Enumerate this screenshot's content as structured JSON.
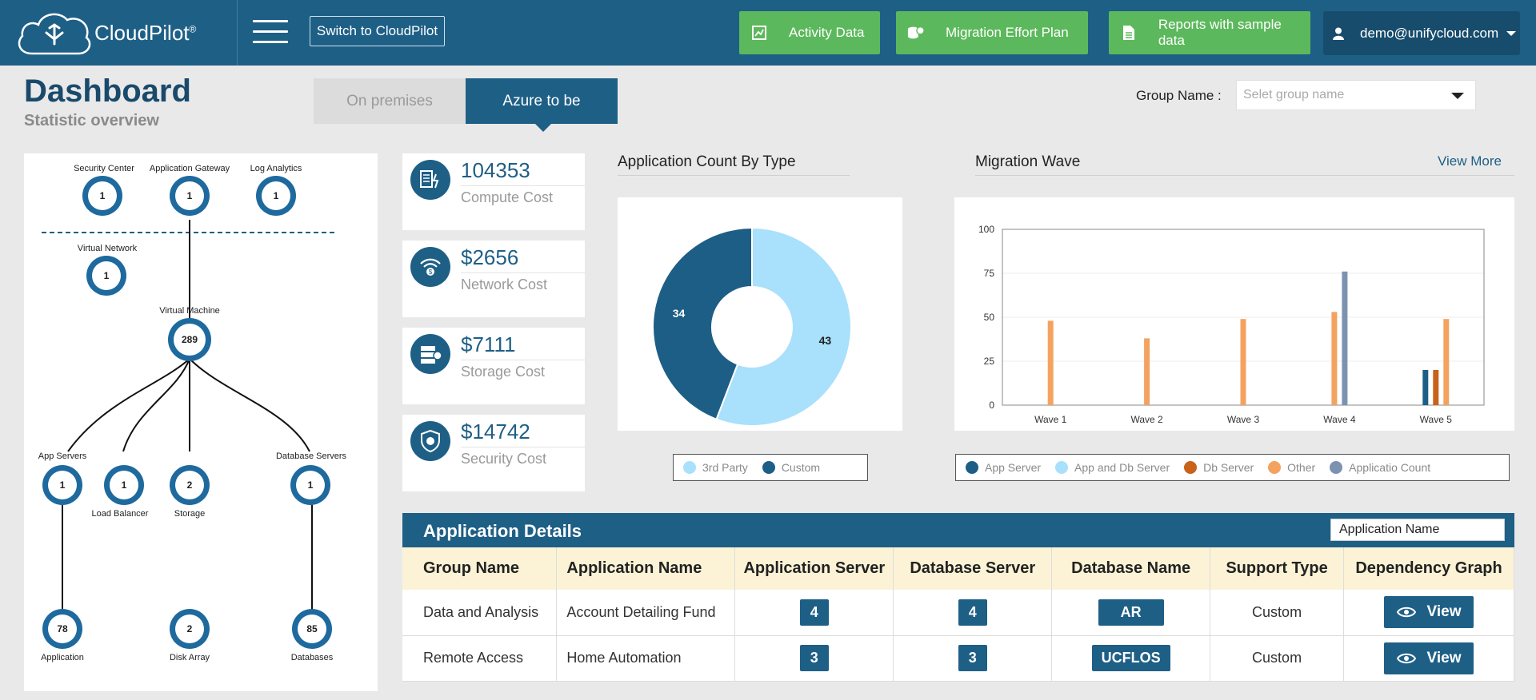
{
  "brand": {
    "name": "CloudPilot",
    "reg": "®"
  },
  "topbar": {
    "switch_label": "Switch to CloudPilot",
    "activity_label": "Activity Data",
    "migration_plan_label": "Migration Effort Plan",
    "reports_label": "Reports with sample data",
    "user_email": "demo@unifycloud.com"
  },
  "header": {
    "title": "Dashboard",
    "subtitle": "Statistic overview"
  },
  "tabs": {
    "onprem": "On premises",
    "azure": "Azure to be"
  },
  "group": {
    "label": "Group Name :",
    "placeholder": "Selet group name"
  },
  "topology": {
    "security_center": {
      "label": "Security Center",
      "count": "1"
    },
    "app_gateway": {
      "label": "Application Gateway",
      "count": "1"
    },
    "log_analytics": {
      "label": "Log Analytics",
      "count": "1"
    },
    "virtual_network": {
      "label": "Virtual Network",
      "count": "1"
    },
    "virtual_machine": {
      "label": "Virtual Machine",
      "count": "289"
    },
    "app_servers": {
      "label": "App Servers",
      "count": "1"
    },
    "load_balancer": {
      "label": "Load Balancer",
      "count": "1"
    },
    "storage": {
      "label": "Storage",
      "count": "2"
    },
    "database_servers": {
      "label": "Database Servers",
      "count": "1"
    },
    "application": {
      "label": "Application",
      "count": "78"
    },
    "disk_array": {
      "label": "Disk Array",
      "count": "2"
    },
    "databases": {
      "label": "Databases",
      "count": "85"
    }
  },
  "stats": {
    "compute": {
      "value": "104353",
      "label": "Compute Cost"
    },
    "network": {
      "value": "$2656",
      "label": "Network Cost"
    },
    "storage": {
      "value": "$7111",
      "label": "Storage Cost"
    },
    "security": {
      "value": "$14742",
      "label": "Security Cost"
    }
  },
  "app_count": {
    "title": "Application Count By Type"
  },
  "migration": {
    "title": "Migration Wave",
    "view_more": "View More"
  },
  "colors": {
    "primary": "#1e5f86",
    "green": "#5cb85c",
    "third_party": "#a9e0fc",
    "custom": "#1d5e86",
    "app_server": "#1d5e86",
    "app_db_server": "#a9e0fc",
    "db_server": "#c9621a",
    "other": "#f4a260",
    "app_count": "#7b93b0"
  },
  "chart_data": [
    {
      "type": "pie",
      "title": "Application Count By Type",
      "categories": [
        "3rd Party",
        "Custom"
      ],
      "values": [
        43,
        34
      ],
      "donut": true,
      "legend": "bottom"
    },
    {
      "type": "bar",
      "title": "Migration Wave",
      "categories": [
        "Wave 1",
        "Wave 2",
        "Wave 3",
        "Wave 4",
        "Wave 5"
      ],
      "ylim": [
        0,
        100
      ],
      "yticks": [
        0,
        25,
        50,
        75,
        100
      ],
      "legend": "bottom",
      "series": [
        {
          "name": "App Server",
          "values": [
            0,
            0,
            0,
            0,
            20
          ]
        },
        {
          "name": "App and Db Server",
          "values": [
            0,
            0,
            0,
            0,
            0
          ]
        },
        {
          "name": "Db Server",
          "values": [
            0,
            0,
            0,
            0,
            20
          ]
        },
        {
          "name": "Other",
          "values": [
            48,
            38,
            49,
            53,
            49
          ]
        },
        {
          "name": "Applicatio Count",
          "values": [
            0,
            0,
            0,
            76,
            0
          ]
        }
      ]
    }
  ],
  "app_details": {
    "title": "Application Details",
    "search_value": "Application Name",
    "columns": [
      "Group Name",
      "Application Name",
      "Application Server",
      "Database Server",
      "Database Name",
      "Support Type",
      "Dependency Graph"
    ],
    "view_label": "View",
    "rows": [
      {
        "group": "Data and Analysis",
        "app": "Account Detailing Fund",
        "app_server": "4",
        "db_server": "4",
        "db_name": "AR",
        "support": "Custom"
      },
      {
        "group": "Remote Access",
        "app": "Home Automation",
        "app_server": "3",
        "db_server": "3",
        "db_name": "UCFLOS",
        "support": "Custom"
      }
    ]
  }
}
